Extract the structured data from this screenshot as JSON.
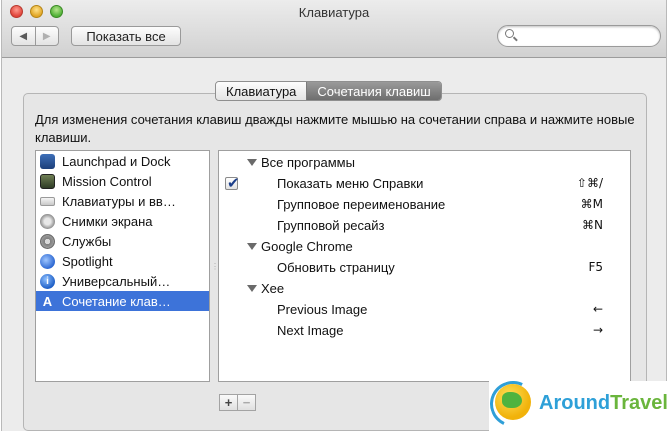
{
  "window": {
    "title": "Клавиатура"
  },
  "toolbar": {
    "back_icon": "back-arrow-icon",
    "forward_icon": "forward-arrow-icon",
    "show_all": "Показать все",
    "search_value": "",
    "search_placeholder": ""
  },
  "tabs": [
    {
      "label": "Клавиатура",
      "active": false
    },
    {
      "label": "Сочетания клавиш",
      "active": true
    }
  ],
  "description": "Для изменения сочетания клавиш дважды нажмите мышью на сочетании справа и нажмите новые клавиши.",
  "categories": [
    {
      "label": "Launchpad и Dock",
      "icon": "launchpad-icon"
    },
    {
      "label": "Mission Control",
      "icon": "mission-control-icon"
    },
    {
      "label": "Клавиатуры и вв…",
      "icon": "keyboard-icon"
    },
    {
      "label": "Снимки экрана",
      "icon": "screenshot-icon"
    },
    {
      "label": "Службы",
      "icon": "gear-icon"
    },
    {
      "label": "Spotlight",
      "icon": "spotlight-icon"
    },
    {
      "label": "Универсальный…",
      "icon": "accessibility-icon"
    },
    {
      "label": "Сочетание клав…",
      "icon": "app-shortcuts-icon",
      "selected": true
    }
  ],
  "shortcut_groups": [
    {
      "name": "Все программы",
      "items": [
        {
          "label": "Показать меню Справки",
          "shortcut": "⇧⌘/",
          "checked": true
        },
        {
          "label": "Групповое переименование",
          "shortcut": "⌘M"
        },
        {
          "label": "Групповой ресайз",
          "shortcut": "⌘N"
        }
      ]
    },
    {
      "name": "Google Chrome",
      "items": [
        {
          "label": "Обновить страницу",
          "shortcut": "F5"
        }
      ]
    },
    {
      "name": "Xee",
      "items": [
        {
          "label": "Previous Image",
          "shortcut": "←"
        },
        {
          "label": "Next Image",
          "shortcut": "→"
        }
      ]
    }
  ],
  "controls": {
    "add": "+",
    "remove": "−"
  },
  "watermark": {
    "part1": "Around",
    "part2": "Travels"
  },
  "colors": {
    "selection": "#3d73d9",
    "watermark_blue": "#2ea0d8",
    "watermark_green": "#6ab53c"
  }
}
